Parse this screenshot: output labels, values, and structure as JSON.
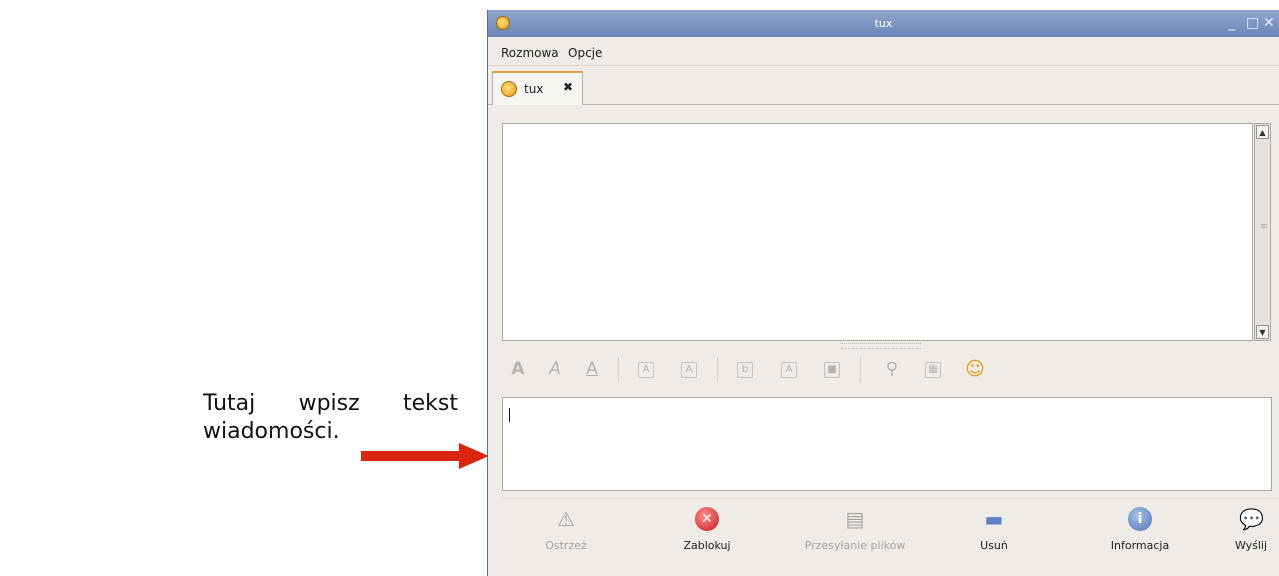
{
  "caption": {
    "words": [
      "Tutaj",
      "wpisz",
      "tekst"
    ],
    "line2": "wiadomości."
  },
  "window": {
    "title": "tux",
    "controls": {
      "minimize": "_",
      "maximize": "□",
      "close": "✕"
    }
  },
  "menu": {
    "items": [
      "Rozmowa",
      "Opcje"
    ]
  },
  "tab": {
    "label": "tux",
    "close_glyph": "✖"
  },
  "format_toolbar": {
    "icons": [
      "bold-icon",
      "italic-icon",
      "underline-icon",
      "font-grow-icon",
      "font-shrink-icon",
      "font-face-icon",
      "fg-color-icon",
      "bg-color-icon",
      "link-icon",
      "image-icon",
      "smiley-icon"
    ]
  },
  "buttons": {
    "warn": "Ostrzeż",
    "block": "Zablokuj",
    "send_file": "Przesyłanie plików",
    "remove": "Usuń",
    "info": "Informacja",
    "send": "Wyślij"
  },
  "colors": {
    "arrow": "#d9260f",
    "titlebar": "#7893c2"
  }
}
